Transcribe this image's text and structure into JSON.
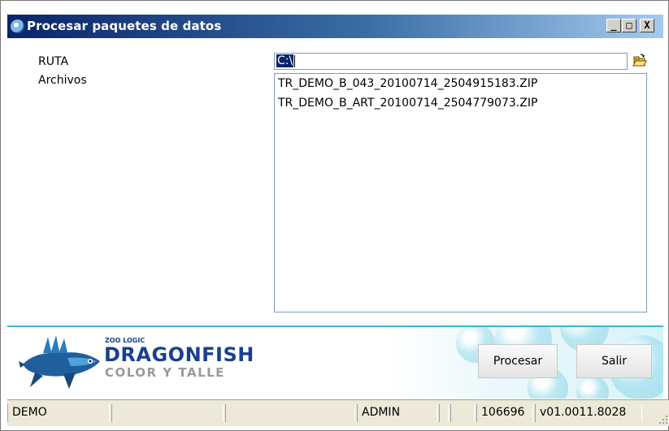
{
  "window": {
    "title": "Procesar paquetes de datos",
    "icon": "app-globe-icon",
    "controls": {
      "minimize": "_",
      "maximize": "□",
      "close": "X"
    }
  },
  "form": {
    "ruta_label": "RUTA",
    "archivos_label": "Archivos",
    "path_value": "C:\\",
    "folder_button_icon": "open-folder-icon"
  },
  "files": [
    "TR_DEMO_B_043_20100714_2504915183.ZIP",
    "TR_DEMO_B_ART_20100714_2504779073.ZIP"
  ],
  "logo": {
    "top": "ZOO LOGIC",
    "main": "DRAGONFISH",
    "sub": "COLOR Y TALLE"
  },
  "buttons": {
    "process": "Procesar",
    "exit": "Salir"
  },
  "status": {
    "c1": "DEMO",
    "c2": "",
    "c3": "",
    "c4": "ADMIN",
    "c5": "",
    "c6": "",
    "c7": "106696",
    "c8": "v01.0011.8028"
  },
  "colors": {
    "title_start": "#0a246a",
    "title_end": "#a6caf0",
    "accent": "#37b7cf",
    "logo_blue": "#1a3f8f"
  }
}
